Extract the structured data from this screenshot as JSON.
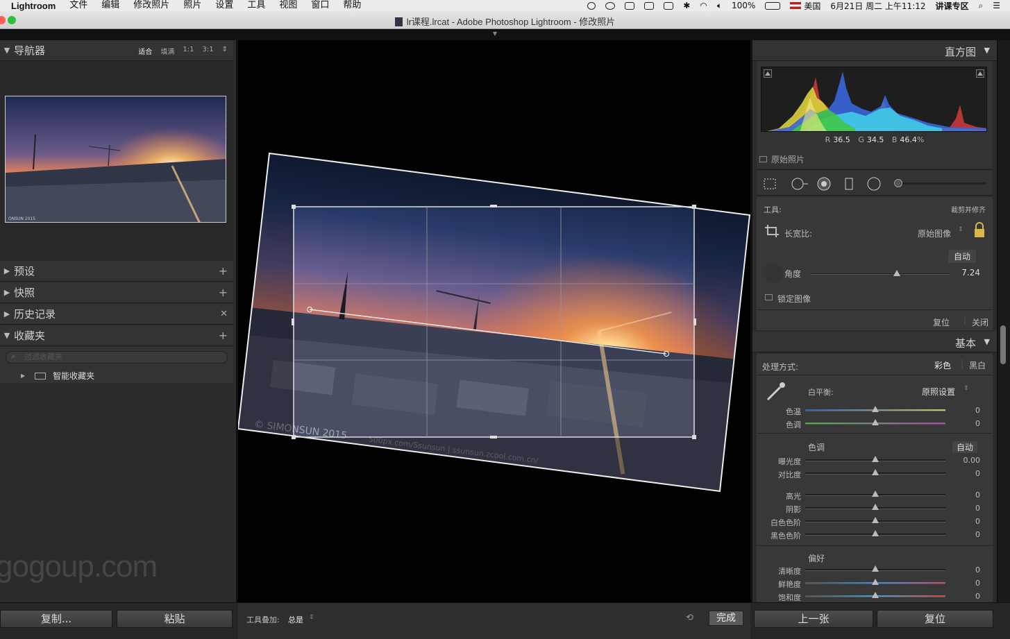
{
  "menubar": {
    "app": "Lightroom",
    "items": [
      "文件",
      "编辑",
      "修改照片",
      "照片",
      "设置",
      "工具",
      "视图",
      "窗口",
      "帮助"
    ],
    "battery": "100%",
    "flag_label": "美国",
    "datetime": "6月21日 周二 上午11:12",
    "user": "讲课专区"
  },
  "window": {
    "title": "lr课程.lrcat - Adobe Photoshop Lightroom - 修改照片"
  },
  "navigator": {
    "title": "导航器",
    "options": [
      "适合",
      "填满",
      "1:1",
      "3:1"
    ],
    "active_option": "适合",
    "thumb_credit": "ONSUN 2015"
  },
  "left_panels": {
    "presets": "预设",
    "snapshots": "快照",
    "history": "历史记录",
    "collections": "收藏夹",
    "search_placeholder": "过滤收藏夹",
    "smart_collections": "智能收藏夹"
  },
  "watermark": "gogoup.com",
  "bottom": {
    "copy": "复制...",
    "paste": "粘贴",
    "toolbar_label": "工具叠加:",
    "toolbar_value": "总是",
    "done": "完成",
    "previous": "上一张",
    "reset": "复位"
  },
  "canvas": {
    "credit": "© SIMONSUN 2015",
    "credit2": "500px.com/Ssunsun  |  ssunsun.zcool.com.cn/"
  },
  "histogram": {
    "title": "直方图",
    "r_label": "R",
    "r": "36.5",
    "g_label": "G",
    "g": "34.5",
    "b_label": "B",
    "b": "46.4",
    "pct": "%",
    "original_photo": "原始照片"
  },
  "crop": {
    "tool_label": "工具:",
    "tool_name": "裁剪并修齐",
    "aspect_label": "长宽比:",
    "aspect_value": "原始图像",
    "auto": "自动",
    "angle_label": "角度",
    "angle_value": "7.24",
    "angle_level": 0.62,
    "constrain": "锁定图像",
    "reset": "复位",
    "close": "关闭"
  },
  "basic": {
    "title": "基本",
    "treatment_label": "处理方式:",
    "color": "彩色",
    "bw": "黑白",
    "wb_label": "白平衡:",
    "wb_value": "原照设置",
    "temp_label": "色温",
    "temp": "0",
    "tint_label": "色调",
    "tint": "0",
    "tone_label": "色调",
    "tone_auto": "自动",
    "exposure_label": "曝光度",
    "exposure": "0.00",
    "contrast_label": "对比度",
    "contrast": "0",
    "highlights_label": "高光",
    "highlights": "0",
    "shadows_label": "阴影",
    "shadows": "0",
    "whites_label": "白色色阶",
    "whites": "0",
    "blacks_label": "黑色色阶",
    "blacks": "0",
    "presence_label": "偏好",
    "clarity_label": "清晰度",
    "clarity": "0",
    "vibrance_label": "鲜艳度",
    "vibrance": "0",
    "saturation_label": "饱和度",
    "saturation": "0"
  },
  "colors": {
    "panel": "#2b2b2b",
    "header": "#333333",
    "green_button": "#2dc13c"
  }
}
